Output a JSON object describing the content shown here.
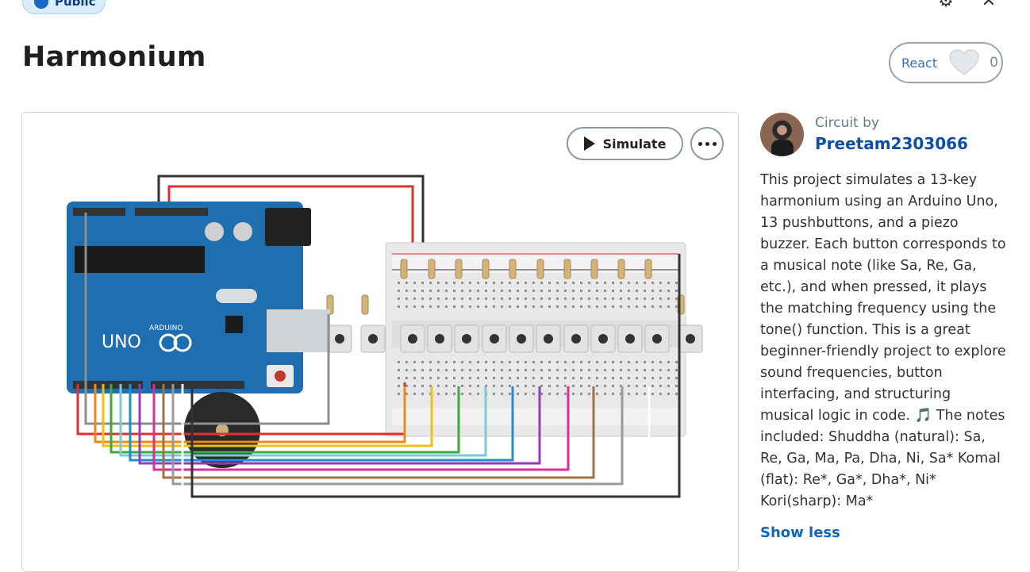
{
  "badge": {
    "label": "Public",
    "icon": "globe-icon"
  },
  "header": {
    "title": "Harmonium",
    "settings_icon": "gear-icon",
    "close_icon": "close-icon"
  },
  "react": {
    "label": "React",
    "count": "0",
    "icon": "heart-icon"
  },
  "canvas": {
    "simulate_label": "Simulate",
    "more_icon": "more-options-icon",
    "board_brand": "ARDUINO",
    "board_model": "UNO"
  },
  "author": {
    "prefix": "Circuit by",
    "name": "Preetam2303066"
  },
  "description": "This project simulates a 13-key harmonium using an Arduino Uno, 13 pushbuttons, and a piezo buzzer. Each button corresponds to a musical note (like Sa, Re, Ga, etc.), and when pressed, it plays the matching frequency using the tone() function. This is a great beginner-friendly project to explore sound frequencies, button interfacing, and structuring musical logic in code. 🎵 The notes included: Shuddha (natural): Sa, Re, Ga, Ma, Pa, Dha, Ni, Sa* Komal (flat): Re*, Ga*, Dha*, Ni* Kori(sharp): Ma*",
  "show_less": "Show less",
  "colors": {
    "accent": "#0d4fa5",
    "link": "#1166c0",
    "board": "#1f6fb0",
    "wire_red": "#e0302e"
  }
}
